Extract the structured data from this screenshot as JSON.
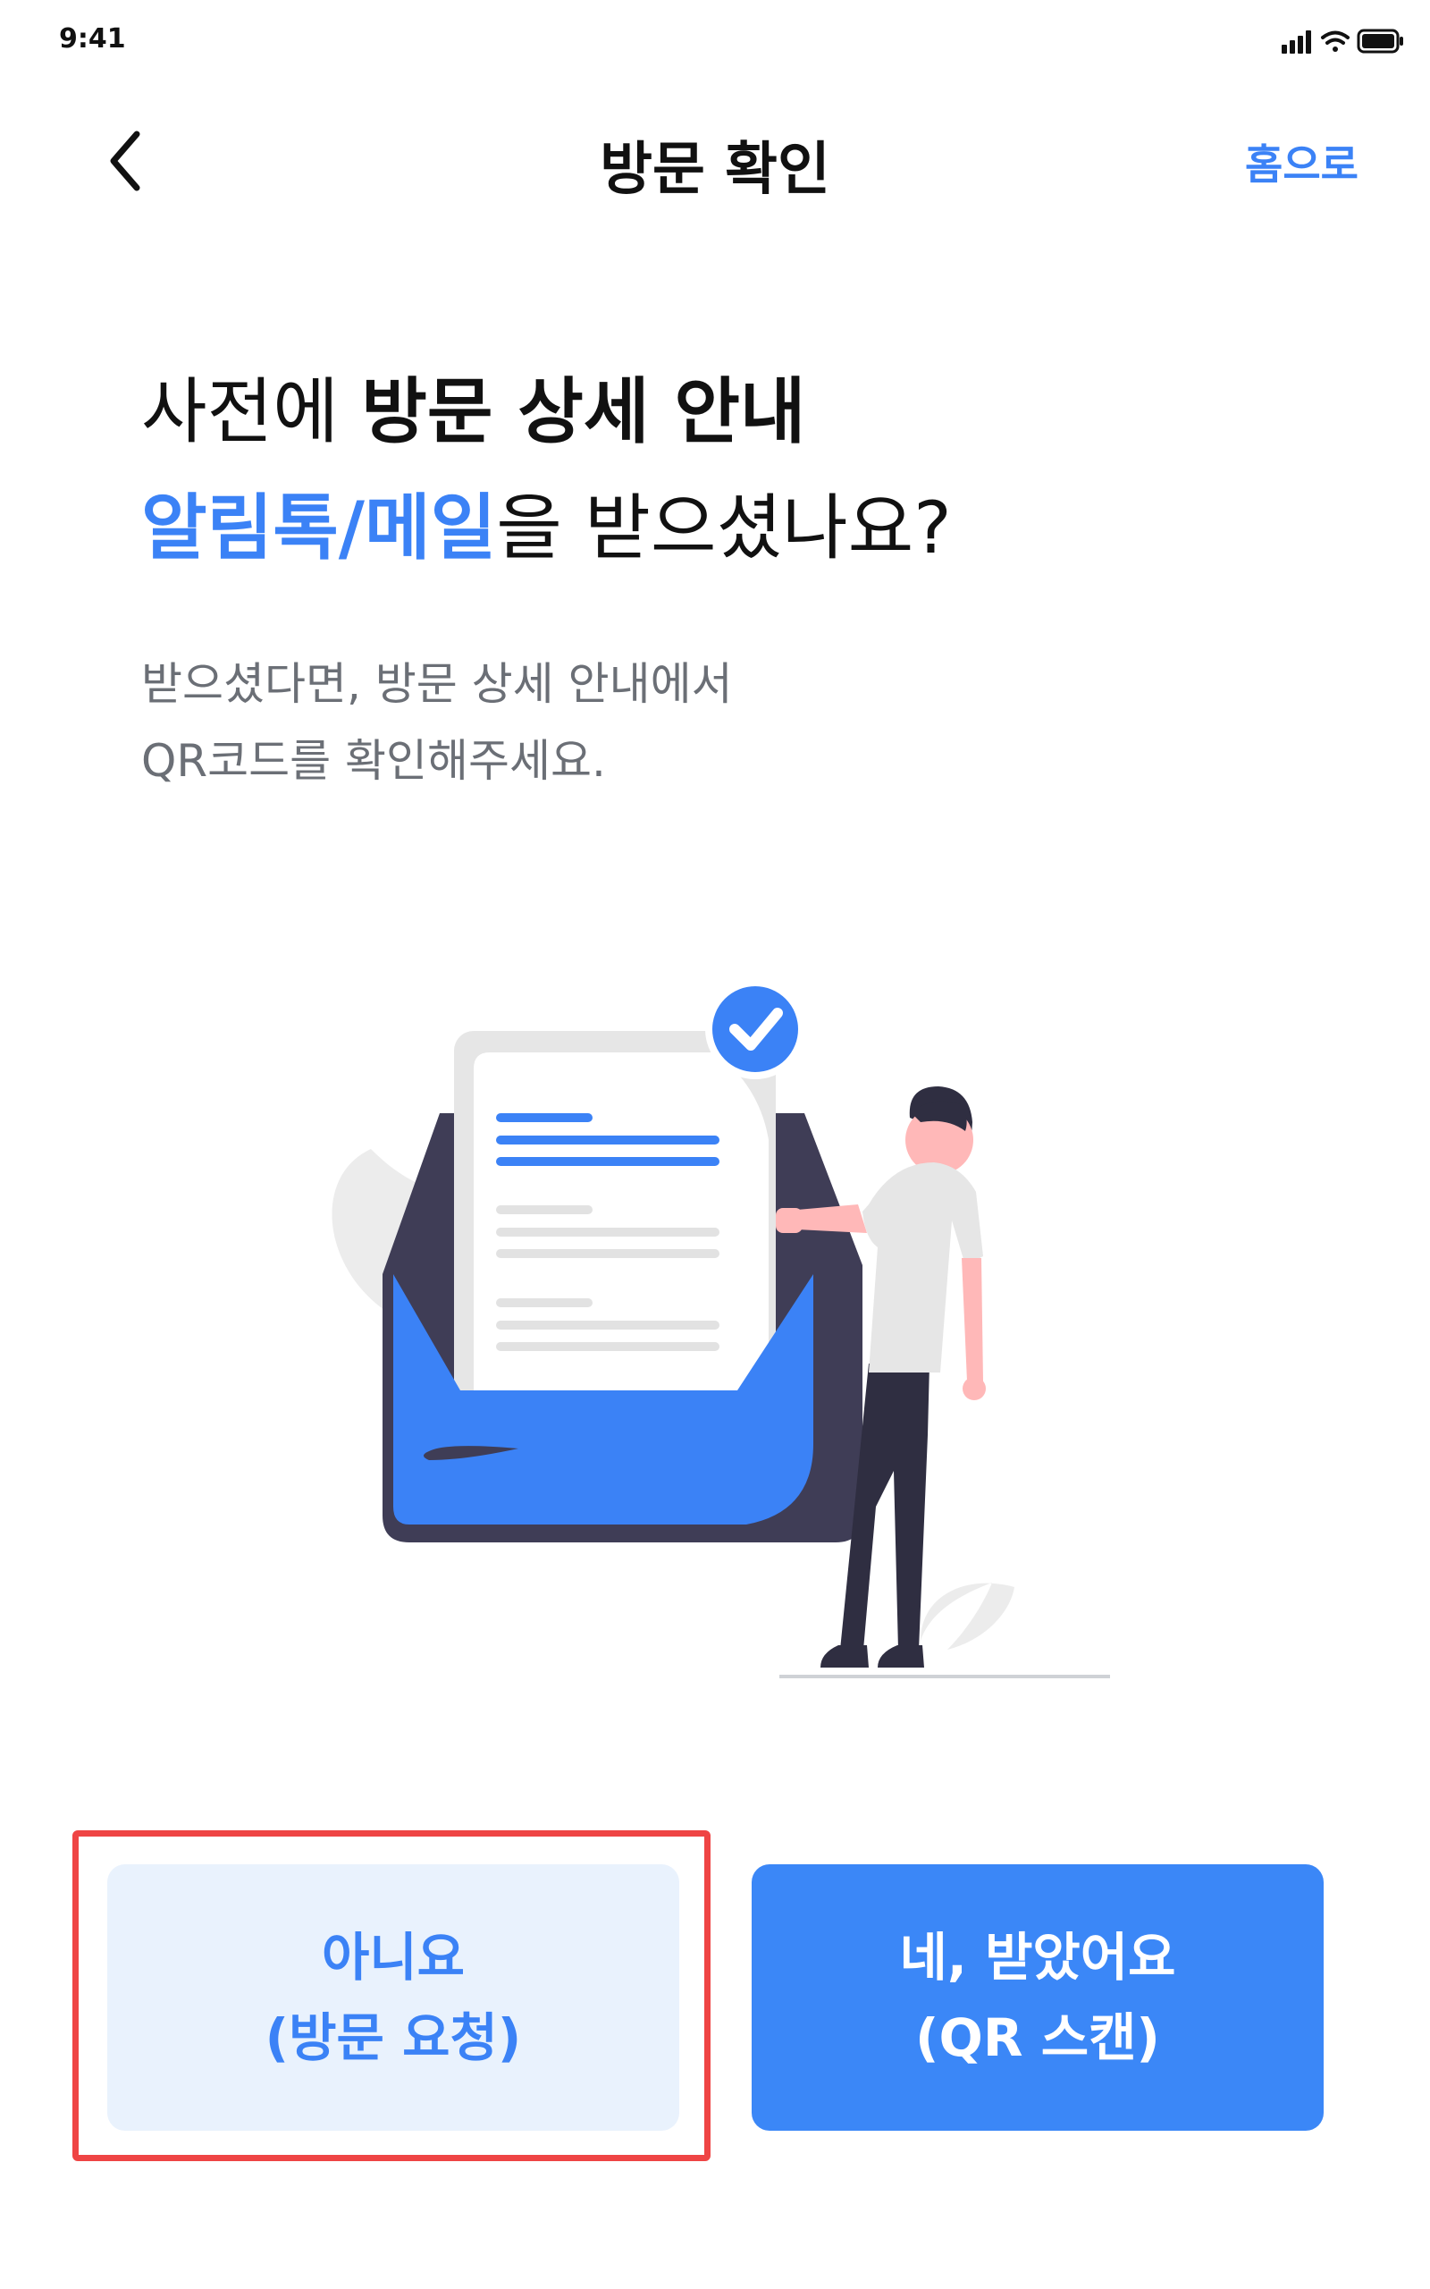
{
  "status_bar": {
    "time": "9:41"
  },
  "nav": {
    "title": "방문 확인",
    "home_label": "홈으로"
  },
  "headline": {
    "line1_normal": "사전에 ",
    "line1_bold": "방문 상세 안내",
    "line2_blue": "알림톡/메일",
    "line2_rest": "을 받으셨나요?"
  },
  "subtext": {
    "line1": "받으셨다면, 방문 상세 안내에서",
    "line2": "QR코드를 확인해주세요."
  },
  "buttons": {
    "no": {
      "line1": "아니요",
      "line2": "(방문 요청)"
    },
    "yes": {
      "line1": "네, 받았어요",
      "line2": "(QR 스캔)"
    }
  },
  "colors": {
    "accent": "#3b82f6",
    "highlight": "#ef4444",
    "no_button_bg": "#e9f2fd",
    "yes_button_bg": "#3b87f7"
  },
  "icons": [
    "back-chevron-icon",
    "signal-icon",
    "wifi-icon",
    "battery-icon",
    "check-circle-icon"
  ]
}
